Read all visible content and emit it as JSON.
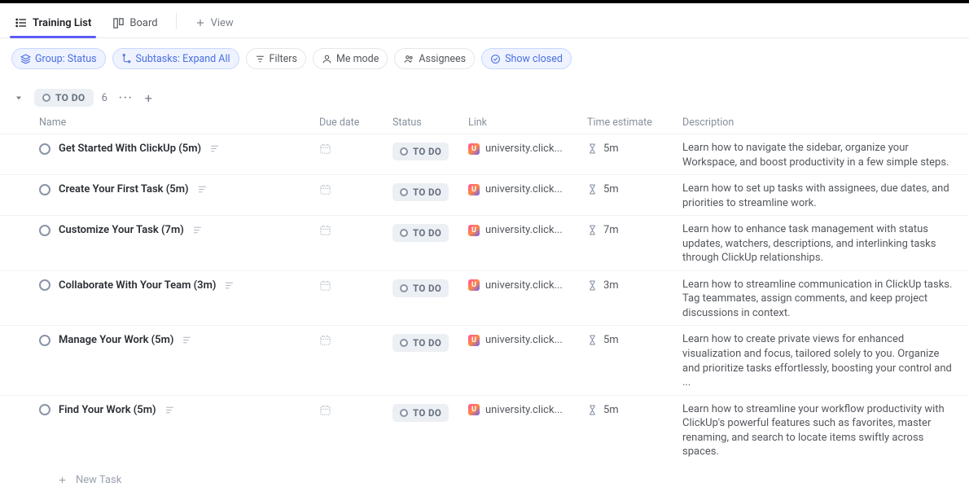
{
  "views": {
    "active": {
      "label": "Training List"
    },
    "board": {
      "label": "Board"
    },
    "add": {
      "label": "View"
    }
  },
  "filters": {
    "group": "Group: Status",
    "subtasks": "Subtasks: Expand All",
    "filters": "Filters",
    "me_mode": "Me mode",
    "assignees": "Assignees",
    "show_closed": "Show closed"
  },
  "group": {
    "label": "TO DO",
    "count": "6"
  },
  "columns": {
    "name": "Name",
    "due": "Due date",
    "status": "Status",
    "link": "Link",
    "time": "Time estimate",
    "desc": "Description"
  },
  "status_label": "TO DO",
  "link_text": "university.click...",
  "tasks": [
    {
      "title": "Get Started With ClickUp (5m)",
      "time": "5m",
      "desc": "Learn how to navigate the sidebar, organize your Workspace, and boost productivity in a few simple steps."
    },
    {
      "title": "Create Your First Task (5m)",
      "time": "5m",
      "desc": "Learn how to set up tasks with assignees, due dates, and priorities to streamline work."
    },
    {
      "title": "Customize Your Task (7m)",
      "time": "7m",
      "desc": "Learn how to enhance task management with status updates, watchers, descriptions, and interlinking tasks through ClickUp relationships."
    },
    {
      "title": "Collaborate With Your Team (3m)",
      "time": "3m",
      "desc": "Learn how to streamline communication in ClickUp tasks. Tag teammates, assign comments, and keep project discussions in context."
    },
    {
      "title": "Manage Your Work (5m)",
      "time": "5m",
      "desc": "Learn how to create private views for enhanced visualization and focus, tailored solely to you. Organize and prioritize tasks effortlessly, boosting your control and ..."
    },
    {
      "title": "Find Your Work (5m)",
      "time": "5m",
      "desc": "Learn how to streamline your workflow productivity with ClickUp's powerful features such as favorites, master renaming, and search to locate items swiftly across spaces."
    }
  ],
  "new_task": "New Task"
}
